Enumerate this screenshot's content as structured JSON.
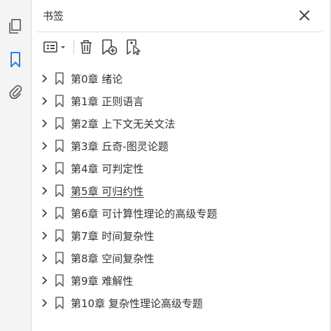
{
  "rail": {
    "icons": [
      "pages-icon",
      "bookmark-icon",
      "attachment-icon"
    ],
    "active": "bookmark-icon",
    "accent": "#1473e6"
  },
  "panel": {
    "title": "书签",
    "close_icon": "close-icon",
    "toolbar": [
      "options-menu-icon",
      "delete-bookmark-icon",
      "new-bookmark-icon",
      "new-bookmark-from-structure-icon"
    ]
  },
  "bookmarks": [
    {
      "label": "第0章  绪论"
    },
    {
      "label": "第1章  正则语言"
    },
    {
      "label": "第2章  上下文无关文法"
    },
    {
      "label": "第3章  丘奇-图灵论题"
    },
    {
      "label": "第4章  可判定性"
    },
    {
      "label": "第5章  可归约性",
      "hovered": true
    },
    {
      "label": "第6章  可计算性理论的高级专题"
    },
    {
      "label": "第7章  时间复杂性"
    },
    {
      "label": "第8章  空间复杂性"
    },
    {
      "label": "第9章  难解性"
    },
    {
      "label": "第10章  复杂性理论高级专题"
    }
  ]
}
